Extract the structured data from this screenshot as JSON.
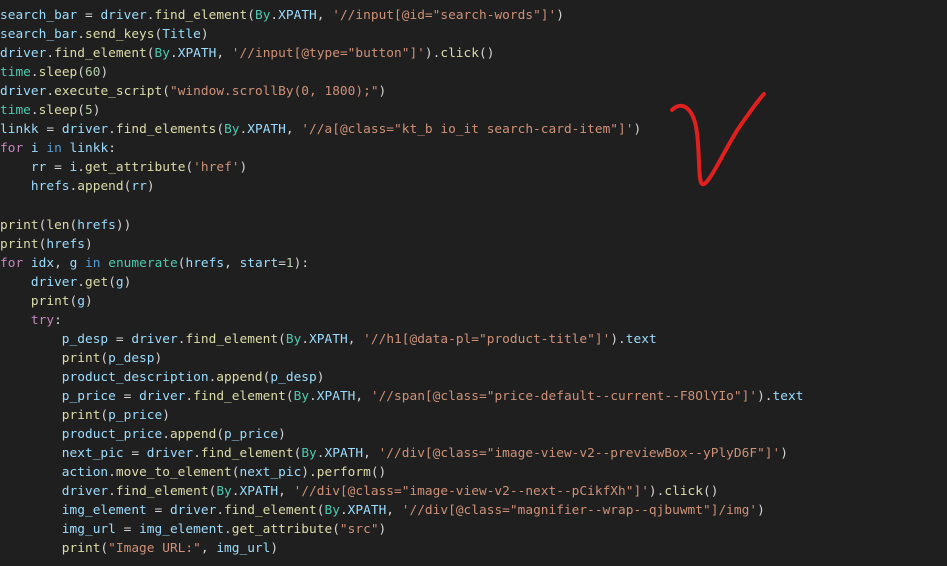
{
  "editor": {
    "code_lines": [
      [
        [
          "var",
          "search_bar"
        ],
        [
          "pl",
          " = "
        ],
        [
          "var",
          "driver"
        ],
        [
          "pl",
          "."
        ],
        [
          "fn",
          "find_element"
        ],
        [
          "pl",
          "("
        ],
        [
          "cls",
          "By"
        ],
        [
          "pl",
          "."
        ],
        [
          "var",
          "XPATH"
        ],
        [
          "pl",
          ", "
        ],
        [
          "str",
          "'//input[@id=\"search-words\"]'"
        ],
        [
          "pl",
          ")"
        ]
      ],
      [
        [
          "var",
          "search_bar"
        ],
        [
          "pl",
          "."
        ],
        [
          "fn",
          "send_keys"
        ],
        [
          "pl",
          "("
        ],
        [
          "var",
          "Title"
        ],
        [
          "pl",
          ")"
        ]
      ],
      [
        [
          "var",
          "driver"
        ],
        [
          "pl",
          "."
        ],
        [
          "fn",
          "find_element"
        ],
        [
          "pl",
          "("
        ],
        [
          "cls",
          "By"
        ],
        [
          "pl",
          "."
        ],
        [
          "var",
          "XPATH"
        ],
        [
          "pl",
          ", "
        ],
        [
          "str",
          "'//input[@type=\"button\"]'"
        ],
        [
          "pl",
          ")."
        ],
        [
          "fn",
          "click"
        ],
        [
          "pl",
          "()"
        ]
      ],
      [
        [
          "cls",
          "time"
        ],
        [
          "pl",
          "."
        ],
        [
          "fn",
          "sleep"
        ],
        [
          "pl",
          "("
        ],
        [
          "num",
          "60"
        ],
        [
          "pl",
          ")"
        ]
      ],
      [
        [
          "var",
          "driver"
        ],
        [
          "pl",
          "."
        ],
        [
          "fn",
          "execute_script"
        ],
        [
          "pl",
          "("
        ],
        [
          "str",
          "\"window.scrollBy(0, 1800);\""
        ],
        [
          "pl",
          ")"
        ]
      ],
      [
        [
          "cls",
          "time"
        ],
        [
          "pl",
          "."
        ],
        [
          "fn",
          "sleep"
        ],
        [
          "pl",
          "("
        ],
        [
          "num",
          "5"
        ],
        [
          "pl",
          ")"
        ]
      ],
      [
        [
          "var",
          "linkk"
        ],
        [
          "pl",
          " = "
        ],
        [
          "var",
          "driver"
        ],
        [
          "pl",
          "."
        ],
        [
          "fn",
          "find_elements"
        ],
        [
          "pl",
          "("
        ],
        [
          "cls",
          "By"
        ],
        [
          "pl",
          "."
        ],
        [
          "var",
          "XPATH"
        ],
        [
          "pl",
          ", "
        ],
        [
          "str",
          "'//a[@class=\"kt_b io_it search-card-item\"]'"
        ],
        [
          "pl",
          ")"
        ]
      ],
      [
        [
          "kw",
          "for"
        ],
        [
          "pl",
          " "
        ],
        [
          "var",
          "i"
        ],
        [
          "pl",
          " "
        ],
        [
          "ctrl",
          "in"
        ],
        [
          "pl",
          " "
        ],
        [
          "var",
          "linkk"
        ],
        [
          "pl",
          ":"
        ]
      ],
      [
        [
          "pl",
          "    "
        ],
        [
          "var",
          "rr"
        ],
        [
          "pl",
          " = "
        ],
        [
          "var",
          "i"
        ],
        [
          "pl",
          "."
        ],
        [
          "fn",
          "get_attribute"
        ],
        [
          "pl",
          "("
        ],
        [
          "str",
          "'href'"
        ],
        [
          "pl",
          ")"
        ]
      ],
      [
        [
          "pl",
          "    "
        ],
        [
          "var",
          "hrefs"
        ],
        [
          "pl",
          "."
        ],
        [
          "fn",
          "append"
        ],
        [
          "pl",
          "("
        ],
        [
          "var",
          "rr"
        ],
        [
          "pl",
          ")"
        ]
      ],
      [],
      [
        [
          "fn",
          "print"
        ],
        [
          "pl",
          "("
        ],
        [
          "fn",
          "len"
        ],
        [
          "pl",
          "("
        ],
        [
          "var",
          "hrefs"
        ],
        [
          "pl",
          "))"
        ]
      ],
      [
        [
          "fn",
          "print"
        ],
        [
          "pl",
          "("
        ],
        [
          "var",
          "hrefs"
        ],
        [
          "pl",
          ")"
        ]
      ],
      [
        [
          "kw",
          "for"
        ],
        [
          "pl",
          " "
        ],
        [
          "var",
          "idx"
        ],
        [
          "pl",
          ", "
        ],
        [
          "var",
          "g"
        ],
        [
          "pl",
          " "
        ],
        [
          "ctrl",
          "in"
        ],
        [
          "pl",
          " "
        ],
        [
          "cls",
          "enumerate"
        ],
        [
          "pl",
          "("
        ],
        [
          "var",
          "hrefs"
        ],
        [
          "pl",
          ", "
        ],
        [
          "var",
          "start"
        ],
        [
          "pl",
          "="
        ],
        [
          "num",
          "1"
        ],
        [
          "pl",
          "):"
        ]
      ],
      [
        [
          "pl",
          "    "
        ],
        [
          "var",
          "driver"
        ],
        [
          "pl",
          "."
        ],
        [
          "fn",
          "get"
        ],
        [
          "pl",
          "("
        ],
        [
          "var",
          "g"
        ],
        [
          "pl",
          ")"
        ]
      ],
      [
        [
          "pl",
          "    "
        ],
        [
          "fn",
          "print"
        ],
        [
          "pl",
          "("
        ],
        [
          "var",
          "g"
        ],
        [
          "pl",
          ")"
        ]
      ],
      [
        [
          "pl",
          "    "
        ],
        [
          "kw",
          "try"
        ],
        [
          "pl",
          ":"
        ]
      ],
      [
        [
          "pl",
          "        "
        ],
        [
          "var",
          "p_desp"
        ],
        [
          "pl",
          " = "
        ],
        [
          "var",
          "driver"
        ],
        [
          "pl",
          "."
        ],
        [
          "fn",
          "find_element"
        ],
        [
          "pl",
          "("
        ],
        [
          "cls",
          "By"
        ],
        [
          "pl",
          "."
        ],
        [
          "var",
          "XPATH"
        ],
        [
          "pl",
          ", "
        ],
        [
          "str",
          "'//h1[@data-pl=\"product-title\"]'"
        ],
        [
          "pl",
          ")."
        ],
        [
          "var",
          "text"
        ]
      ],
      [
        [
          "pl",
          "        "
        ],
        [
          "fn",
          "print"
        ],
        [
          "pl",
          "("
        ],
        [
          "var",
          "p_desp"
        ],
        [
          "pl",
          ")"
        ]
      ],
      [
        [
          "pl",
          "        "
        ],
        [
          "var",
          "product_description"
        ],
        [
          "pl",
          "."
        ],
        [
          "fn",
          "append"
        ],
        [
          "pl",
          "("
        ],
        [
          "var",
          "p_desp"
        ],
        [
          "pl",
          ")"
        ]
      ],
      [
        [
          "pl",
          "        "
        ],
        [
          "var",
          "p_price"
        ],
        [
          "pl",
          " = "
        ],
        [
          "var",
          "driver"
        ],
        [
          "pl",
          "."
        ],
        [
          "fn",
          "find_element"
        ],
        [
          "pl",
          "("
        ],
        [
          "cls",
          "By"
        ],
        [
          "pl",
          "."
        ],
        [
          "var",
          "XPATH"
        ],
        [
          "pl",
          ", "
        ],
        [
          "str",
          "'//span[@class=\"price-default--current--F8OlYIo\"]'"
        ],
        [
          "pl",
          ")."
        ],
        [
          "var",
          "text"
        ]
      ],
      [
        [
          "pl",
          "        "
        ],
        [
          "fn",
          "print"
        ],
        [
          "pl",
          "("
        ],
        [
          "var",
          "p_price"
        ],
        [
          "pl",
          ")"
        ]
      ],
      [
        [
          "pl",
          "        "
        ],
        [
          "var",
          "product_price"
        ],
        [
          "pl",
          "."
        ],
        [
          "fn",
          "append"
        ],
        [
          "pl",
          "("
        ],
        [
          "var",
          "p_price"
        ],
        [
          "pl",
          ")"
        ]
      ],
      [
        [
          "pl",
          "        "
        ],
        [
          "var",
          "next_pic"
        ],
        [
          "pl",
          " = "
        ],
        [
          "var",
          "driver"
        ],
        [
          "pl",
          "."
        ],
        [
          "fn",
          "find_element"
        ],
        [
          "pl",
          "("
        ],
        [
          "cls",
          "By"
        ],
        [
          "pl",
          "."
        ],
        [
          "var",
          "XPATH"
        ],
        [
          "pl",
          ", "
        ],
        [
          "str",
          "'//div[@class=\"image-view-v2--previewBox--yPlyD6F\"]'"
        ],
        [
          "pl",
          ")"
        ]
      ],
      [
        [
          "pl",
          "        "
        ],
        [
          "var",
          "action"
        ],
        [
          "pl",
          "."
        ],
        [
          "fn",
          "move_to_element"
        ],
        [
          "pl",
          "("
        ],
        [
          "var",
          "next_pic"
        ],
        [
          "pl",
          ")."
        ],
        [
          "fn",
          "perform"
        ],
        [
          "pl",
          "()"
        ]
      ],
      [
        [
          "pl",
          "        "
        ],
        [
          "var",
          "driver"
        ],
        [
          "pl",
          "."
        ],
        [
          "fn",
          "find_element"
        ],
        [
          "pl",
          "("
        ],
        [
          "cls",
          "By"
        ],
        [
          "pl",
          "."
        ],
        [
          "var",
          "XPATH"
        ],
        [
          "pl",
          ", "
        ],
        [
          "str",
          "'//div[@class=\"image-view-v2--next--pCikfXh\"]'"
        ],
        [
          "pl",
          ")."
        ],
        [
          "fn",
          "click"
        ],
        [
          "pl",
          "()"
        ]
      ],
      [
        [
          "pl",
          "        "
        ],
        [
          "var",
          "img_element"
        ],
        [
          "pl",
          " = "
        ],
        [
          "var",
          "driver"
        ],
        [
          "pl",
          "."
        ],
        [
          "fn",
          "find_element"
        ],
        [
          "pl",
          "("
        ],
        [
          "cls",
          "By"
        ],
        [
          "pl",
          "."
        ],
        [
          "var",
          "XPATH"
        ],
        [
          "pl",
          ", "
        ],
        [
          "str",
          "'//div[@class=\"magnifier--wrap--qjbuwmt\"]/img'"
        ],
        [
          "pl",
          ")"
        ]
      ],
      [
        [
          "pl",
          "        "
        ],
        [
          "var",
          "img_url"
        ],
        [
          "pl",
          " = "
        ],
        [
          "var",
          "img_element"
        ],
        [
          "pl",
          "."
        ],
        [
          "fn",
          "get_attribute"
        ],
        [
          "pl",
          "("
        ],
        [
          "str",
          "\"src\""
        ],
        [
          "pl",
          ")"
        ]
      ],
      [
        [
          "pl",
          "        "
        ],
        [
          "fn",
          "print"
        ],
        [
          "pl",
          "("
        ],
        [
          "str",
          "\"Image URL:\""
        ],
        [
          "pl",
          ", "
        ],
        [
          "var",
          "img_url"
        ],
        [
          "pl",
          ")"
        ]
      ]
    ]
  },
  "annotation": {
    "type": "handwritten-checkmark-icon",
    "color": "#e01f1f"
  },
  "theme": {
    "background": "#1f1f1f",
    "variable": "#9cdcfe",
    "function": "#dcdcaa",
    "class": "#4ec9b0",
    "string": "#ce9178",
    "number": "#b5cea8",
    "keyword": "#c586c0",
    "operator_keyword": "#569cd6",
    "plain": "#d4d4d4"
  }
}
